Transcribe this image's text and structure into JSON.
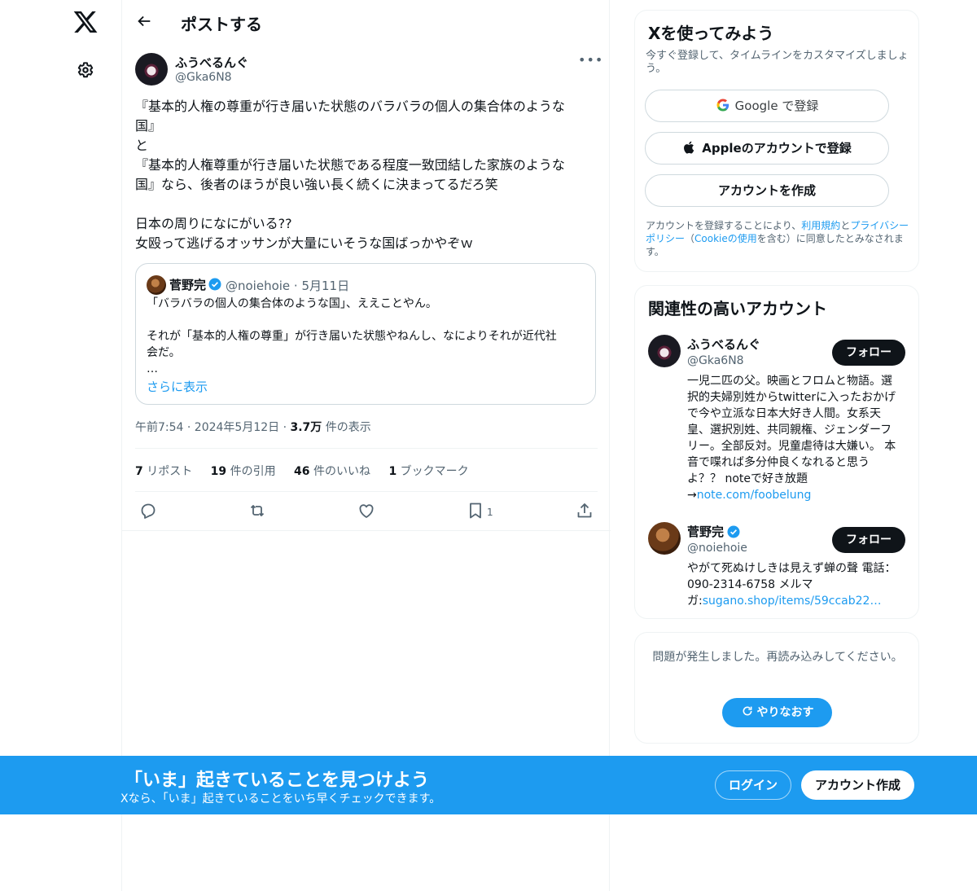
{
  "header": {
    "title": "ポストする"
  },
  "tweet": {
    "author_name": "ふうべるんぐ",
    "author_handle": "@Gka6N8",
    "text": "『基本的人権の尊重が行き届いた状態のバラバラの個人の集合体のような\n国』\nと\n『基本的人権尊重が行き届いた状態である程度一致団結した家族のような\n国』なら、後者のほうが良い強い長く続くに決まってるだろ笑\n\n日本の周りになにがいる??\n女殴って逃げるオッサンが大量にいそうな国ばっかやぞｗ",
    "time": "午前7:54 · 2024年5月12日 · ",
    "views_count": "3.7万",
    "views_label": " 件の表示"
  },
  "quote": {
    "name": "菅野完",
    "handle_date": "@noiehoie · 5月11日",
    "text": "「バラバラの個人の集合体のような国」、ええことやん。\n\nそれが「基本的人権の尊重」が行き届いた状態やねんし、なによりそれが近代社\n会だ。\n…",
    "show_more": "さらに表示"
  },
  "stats": {
    "reposts_count": "7",
    "reposts_label": " リポスト",
    "quotes_count": "19",
    "quotes_label": " 件の引用",
    "likes_count": "46",
    "likes_label": " 件のいいね",
    "bookmarks_count": "1",
    "bookmarks_label": " ブックマーク"
  },
  "actions": {
    "bookmark_count": "1"
  },
  "signup": {
    "title": "Xを使ってみよう",
    "subtitle": "今すぐ登録して、タイムラインをカスタマイズしましょう。",
    "google": "Google で登録",
    "apple": "Appleのアカウントで登録",
    "create": "アカウントを作成",
    "legal_1": "アカウントを登録することにより、",
    "terms": "利用規約",
    "legal_2": "と",
    "privacy": "プライバシーポリシー",
    "legal_3": "（",
    "cookie": "Cookieの使用",
    "legal_4": "を含む）に同意したとみなされます。"
  },
  "related": {
    "title": "関連性の高いアカウント",
    "follow_label": "フォロー",
    "accounts": [
      {
        "name": "ふうべるんぐ",
        "handle": "@Gka6N8",
        "bio": "一児二匹の父。映画とフロムと物語。選択的夫婦別姓からtwitterに入ったおかげで今や立派な日本大好き人間。女系天皇、選択別姓、共同親権、ジェンダーフリー。全部反対。児童虐待は大嫌い。 本音で喋れば多分仲良くなれると思うよ？？ noteで好き放題→",
        "bio_link": "note.com/foobelung"
      },
      {
        "name": "菅野完",
        "handle": "@noiehoie",
        "bio": "やがて死ぬけしきは見えず蝉の聲 電話：090-2314-6758 メルマガ:",
        "bio_link": "sugano.shop/items/59ccab22…"
      }
    ]
  },
  "error": {
    "message": "問題が発生しました。再読み込みしてください。",
    "retry": "やりなおす"
  },
  "banner": {
    "title": "「いま」起きていることを見つけよう",
    "subtitle": "Xなら、「いま」起きていることをいち早くチェックできます。",
    "login": "ログイン",
    "signup": "アカウント作成"
  },
  "colors": {
    "accent": "#1d9bf0",
    "text": "#0f1419",
    "muted": "#536471",
    "border": "#eff3f4"
  },
  "icons": [
    "x-logo-icon",
    "gear-icon",
    "back-arrow-icon",
    "more-icon",
    "verified-icon",
    "reply-icon",
    "repost-icon",
    "like-icon",
    "bookmark-icon",
    "share-icon",
    "google-icon",
    "apple-icon",
    "refresh-icon"
  ]
}
